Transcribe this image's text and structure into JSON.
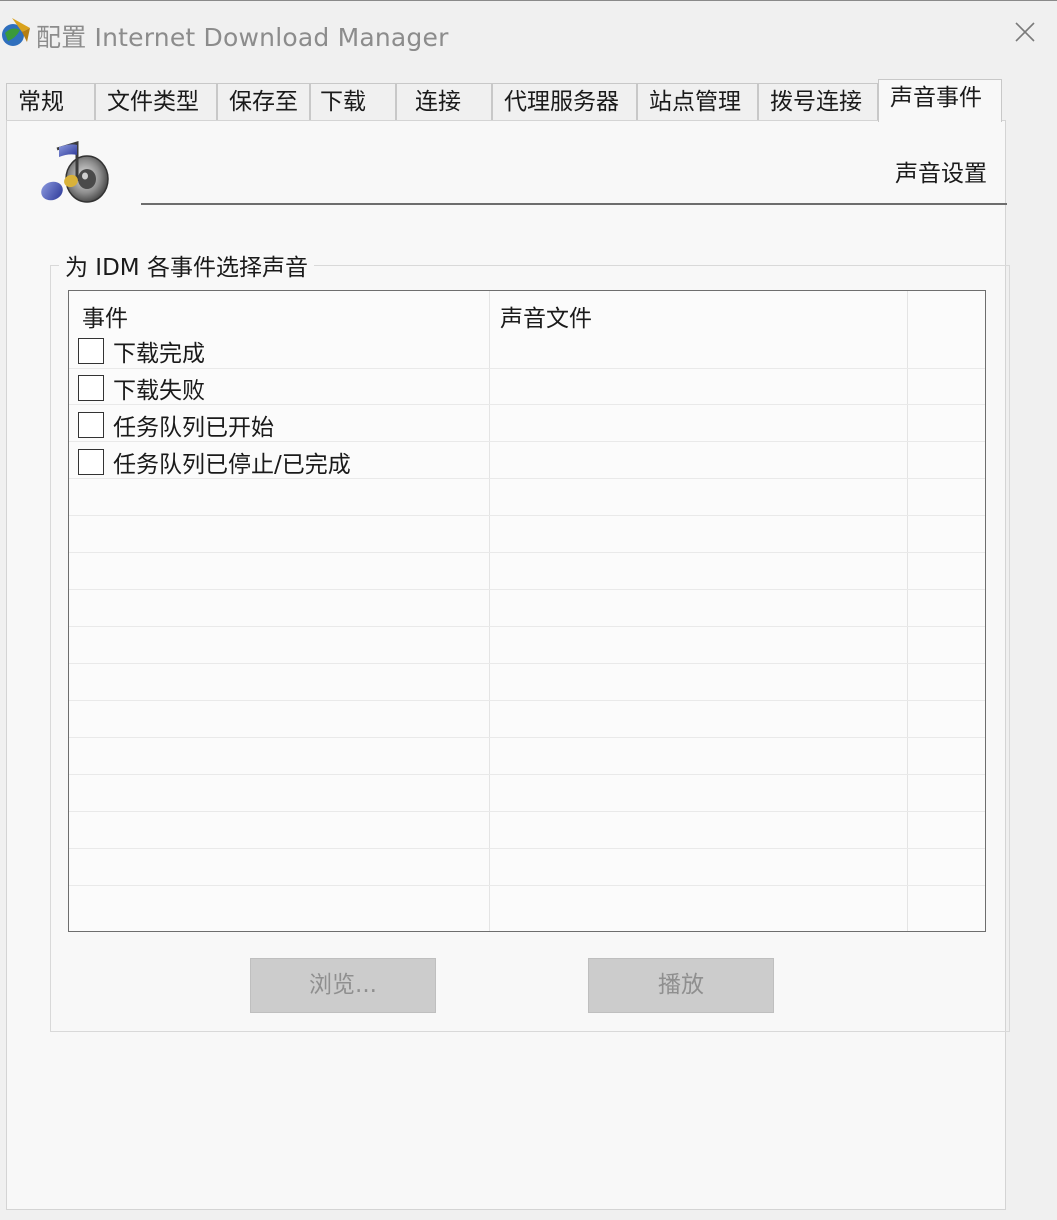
{
  "window": {
    "title": "配置 Internet Download Manager"
  },
  "tabs": [
    {
      "label": "常规",
      "active": false
    },
    {
      "label": "文件类型",
      "active": false
    },
    {
      "label": "保存至",
      "active": false
    },
    {
      "label": "下载",
      "active": false
    },
    {
      "label": "连接",
      "active": false
    },
    {
      "label": "代理服务器",
      "active": false
    },
    {
      "label": "站点管理",
      "active": false
    },
    {
      "label": "拨号连接",
      "active": false
    },
    {
      "label": "声音事件",
      "active": true
    }
  ],
  "panel": {
    "header_label": "声音设置",
    "group_title": "为 IDM 各事件选择声音",
    "columns": {
      "event": "事件",
      "sound_file": "声音文件"
    },
    "events": [
      {
        "label": "下载完成",
        "checked": false,
        "sound_file": ""
      },
      {
        "label": "下载失败",
        "checked": false,
        "sound_file": ""
      },
      {
        "label": "任务队列已开始",
        "checked": false,
        "sound_file": ""
      },
      {
        "label": "任务队列已停止/已完成",
        "checked": false,
        "sound_file": ""
      }
    ],
    "buttons": {
      "browse": "浏览...",
      "play": "播放"
    }
  },
  "icons": {
    "app": "idm-globe-icon",
    "close": "close-icon",
    "sound": "music-note-speaker-icon"
  }
}
